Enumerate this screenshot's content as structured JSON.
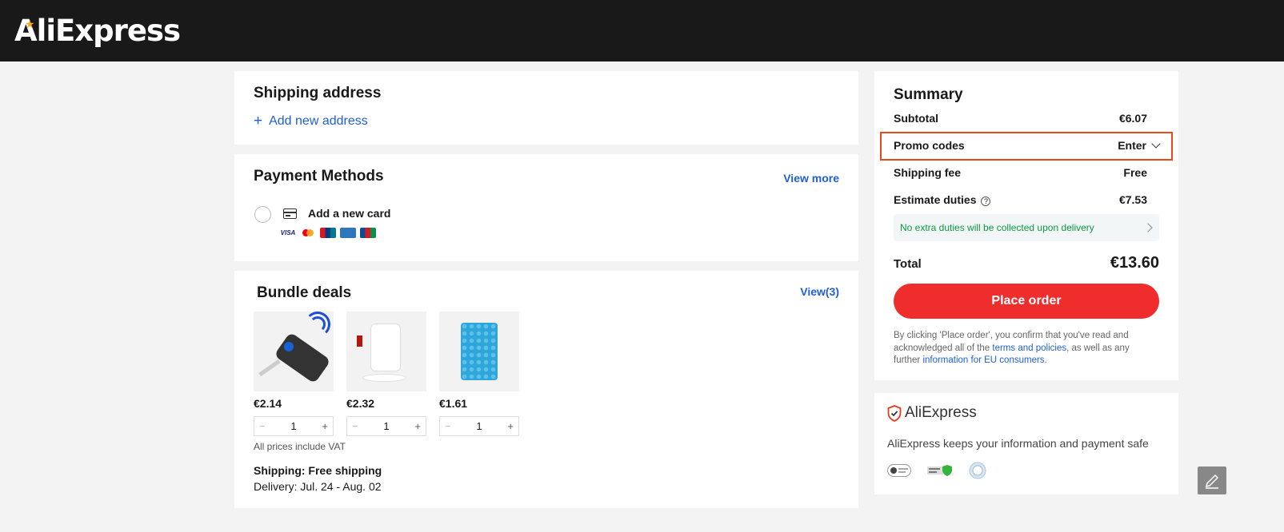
{
  "header": {
    "logo_text": "AliExpress"
  },
  "shipping": {
    "title": "Shipping address",
    "add_address": "Add new address"
  },
  "payment": {
    "title": "Payment Methods",
    "view_more": "View more",
    "add_card": "Add a new card",
    "brands": [
      "VISA",
      "Mastercard",
      "UnionPay",
      "Amex",
      "JCB"
    ]
  },
  "bundle": {
    "title": "Bundle deals",
    "view_count": "View(3)",
    "products": [
      {
        "price": "€2.14",
        "qty": "1",
        "minus": "−",
        "plus": "+"
      },
      {
        "price": "€2.32",
        "qty": "1",
        "minus": "−",
        "plus": "+"
      },
      {
        "price": "€1.61",
        "qty": "1",
        "minus": "−",
        "plus": "+"
      }
    ],
    "vat_note": "All prices include VAT",
    "shipping_line": "Shipping: Free shipping",
    "delivery_line": "Delivery: Jul. 24 - Aug. 02"
  },
  "summary": {
    "title": "Summary",
    "subtotal_label": "Subtotal",
    "subtotal_value": "€6.07",
    "promo_label": "Promo codes",
    "promo_action": "Enter",
    "shipping_label": "Shipping fee",
    "shipping_value": "Free",
    "duties_label": "Estimate duties",
    "duties_value": "€7.53",
    "duties_note": "No extra duties will be collected upon delivery",
    "total_label": "Total",
    "total_value": "€13.60",
    "place_order": "Place order",
    "legal_prefix": "By clicking 'Place order', you confirm that you've read and acknowledged all of the ",
    "legal_link1": "terms and policies",
    "legal_middle": ", as well as any further ",
    "legal_link2": "information for EU consumers",
    "legal_suffix": "."
  },
  "safety": {
    "brand": "AliExpress",
    "text": "AliExpress keeps your information and payment safe"
  },
  "colors": {
    "accent_blue": "#1f5fd8",
    "place_order_red": "#f02d2d",
    "promo_highlight": "#e84a1a",
    "duties_green": "#0a9b3f"
  }
}
